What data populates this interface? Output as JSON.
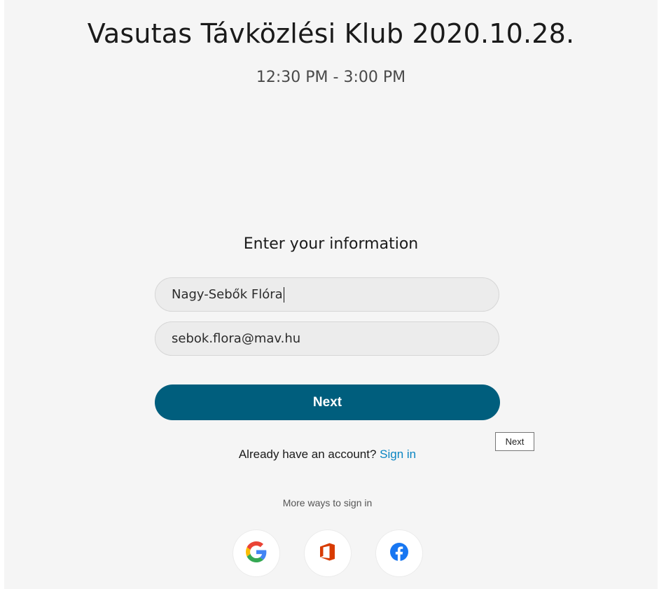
{
  "meeting": {
    "title": "Vasutas Távközlési Klub 2020.10.28.",
    "time": "12:30 PM - 3:00 PM"
  },
  "form": {
    "heading": "Enter your information",
    "name_value": "Nagy-Sebők Flóra",
    "email_value": "sebok.flora@mav.hu",
    "next_label": "Next",
    "tooltip": "Next",
    "already_text": "Already have an account? ",
    "signin_label": "Sign in",
    "more_ways": "More ways to sign in"
  },
  "social": [
    {
      "icon": "google-icon"
    },
    {
      "icon": "office-icon"
    },
    {
      "icon": "facebook-icon"
    }
  ],
  "colors": {
    "primary_button": "#005e7d",
    "link": "#0a85c2",
    "background": "#f5f5f5"
  }
}
